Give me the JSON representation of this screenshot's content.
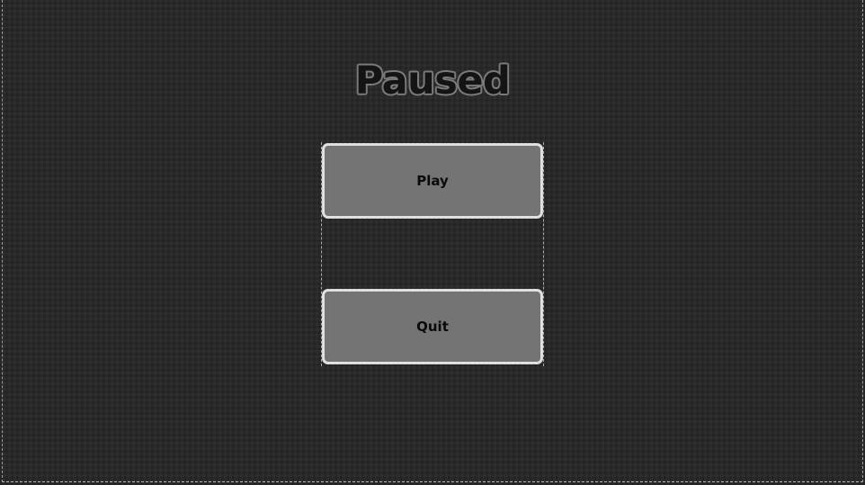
{
  "pause_menu": {
    "title": "Paused",
    "buttons": {
      "play_label": "Play",
      "quit_label": "Quit"
    }
  },
  "colors": {
    "background": "#282828",
    "button_fill": "#747474",
    "button_border": "#e2e2e2",
    "title_fill": "#141414",
    "title_outline": "#7a7a7a"
  }
}
